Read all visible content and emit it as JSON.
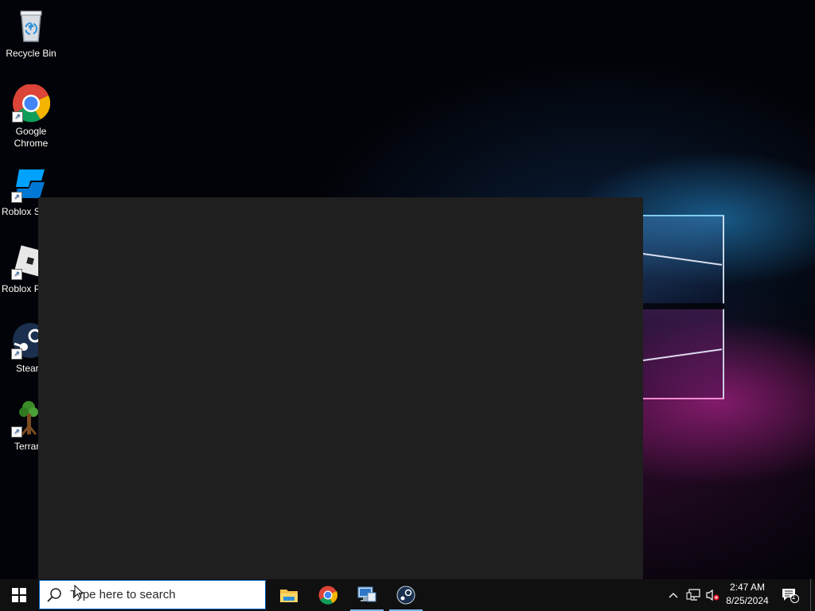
{
  "desktop": {
    "icons": [
      {
        "label": "Recycle Bin",
        "icon": "recycle-bin-icon"
      },
      {
        "label": "Google Chrome",
        "icon": "chrome-icon"
      },
      {
        "label": "Roblox S",
        "icon": "roblox-studio-icon"
      },
      {
        "label": "Roblox P",
        "icon": "roblox-player-icon"
      },
      {
        "label": "Stear",
        "icon": "steam-icon"
      },
      {
        "label": "Terrar",
        "icon": "terraria-icon"
      }
    ]
  },
  "taskbar": {
    "search": {
      "placeholder": "Type here to search",
      "value": ""
    },
    "apps": [
      {
        "name": "File Explorer",
        "icon": "file-explorer-icon",
        "active": false
      },
      {
        "name": "Google Chrome",
        "icon": "chrome-icon",
        "active": false
      },
      {
        "name": "Remote Desktop",
        "icon": "remote-desktop-icon",
        "active": true
      },
      {
        "name": "Steam",
        "icon": "steam-icon",
        "active": true
      }
    ],
    "clock": {
      "time": "2:47 AM",
      "date": "8/25/2024"
    },
    "notifications": {
      "count": "1"
    }
  },
  "colors": {
    "taskbar": "#101010",
    "window": "#1f1f1f",
    "accent": "#76b9ed",
    "search_border": "#0a64c8"
  }
}
